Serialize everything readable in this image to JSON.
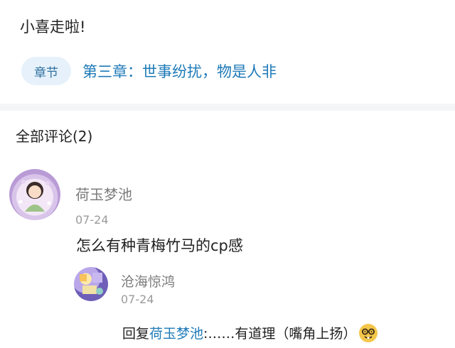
{
  "post": {
    "text": "小喜走啦!"
  },
  "chapter": {
    "badge": "章节",
    "title": "第三章：世事纷扰，物是人非"
  },
  "comments": {
    "header": "全部评论(2)",
    "items": [
      {
        "author": "荷玉梦池",
        "date": "07-24",
        "text": "怎么有种青梅竹马的cp感",
        "replies": [
          {
            "author": "沧海惊鸿",
            "date": "07-24",
            "reply_prefix": "回复",
            "reply_target": "荷玉梦池",
            "reply_text": ":……有道理（嘴角上扬）"
          }
        ]
      }
    ]
  },
  "icons": {
    "emoji": "nerd-face-icon"
  },
  "colors": {
    "accent": "#1e7ab8",
    "badge_bg": "#e6f1fb",
    "divider": "#f4f5f7"
  }
}
